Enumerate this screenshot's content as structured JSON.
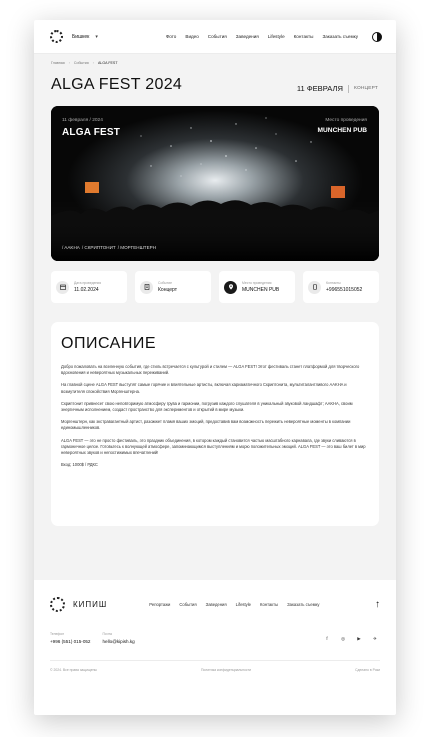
{
  "header": {
    "city": "Бишкек",
    "nav": [
      "Фото",
      "Видео",
      "События",
      "Заведения",
      "Lifestyle",
      "Контакты",
      "Заказать съемку"
    ]
  },
  "breadcrumb": [
    "Главная",
    "События",
    "ALGA FEST"
  ],
  "event": {
    "title": "ALGA FEST 2024",
    "date": "11 ФЕВРАЛЯ",
    "kind": "КОНЦЕРТ"
  },
  "banner": {
    "date_label": "11 февраля / 2024",
    "title": "ALGA FEST",
    "venue_label": "Место проведения",
    "venue": "MUNCHEN PUB",
    "artists": [
      "/ AAKHA",
      "/ СКРИПТОНИТ",
      "/ МОРГЕНШТЕРН"
    ]
  },
  "cards": [
    {
      "label": "Дата проведения",
      "value": "11.02.2024",
      "icon": "calendar-icon"
    },
    {
      "label": "Событие",
      "value": "Концерт",
      "icon": "event-icon"
    },
    {
      "label": "Место проведения",
      "value": "MUNCHEN PUB",
      "icon": "location-icon"
    },
    {
      "label": "Контакты",
      "value": "+996551015052",
      "icon": "phone-icon"
    }
  ],
  "description": {
    "heading": "ОПИСАНИЕ",
    "paragraphs": [
      "Добро пожаловать на вселенную события, где стиль встречается с культурой и стилем — ALGA FEST! Этот фестиваль станет платформой для творческого вдохновения и невероятных музыкальных переживаний.",
      "На главной сцене ALGA FEST выступят самые горячие и влиятельные артисты, включая харизматичного Скриптонита, мультиталантливого AAKHA и возмутителя спокойствия Моргенштерна.",
      "Скриптонит привнесет свою неповторимую атмосферу грува и гармонии, погрузив каждого слушателя в уникальный звуковой ландшафт; AAKHA, своим энергичным исполнением, создаст пространство для экспериментов и открытий в мире музыки.",
      "Моргенштерн, как экстравагантный артист, разожжет пламя ваших эмоций, предоставив вам возможность пережить невероятные моменты в компании единомышленников.",
      "ALGA FEST — это не просто фестиваль, это праздник объединения, в котором каждый становится частью масштабного карнавала, где звуки сливаются в гармоничное целое. Готовьтесь к волнующей атмосфере, запоминающимся выступлениям и морю положительных эмоций. ALGA FEST — это ваш билет в мир невероятных звуков и непостижимых впечатлений!",
      "Вход: 1000$ / РДКС"
    ]
  },
  "footer": {
    "brand": "КИПИШ",
    "nav": [
      "Репортажи",
      "События",
      "Заведения",
      "Lifestyle",
      "Контакты",
      "Заказать съемку"
    ],
    "phone_label": "Телефон",
    "phone": "+996 (551) 015-052",
    "email_label": "Почта",
    "email": "hello@kipish.kg",
    "social": [
      "f",
      "◎",
      "▶",
      "✈"
    ],
    "copyright": "© 2024. Все права защищены",
    "privacy": "Политика конфиденциальности",
    "credit": "Сделано в Роки"
  }
}
